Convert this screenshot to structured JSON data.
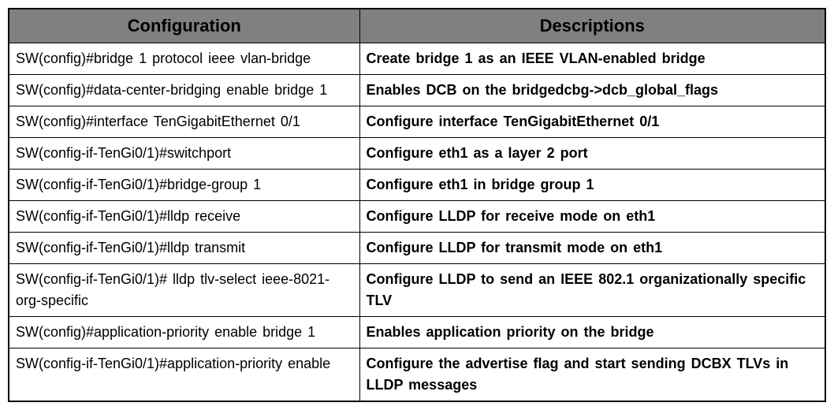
{
  "headers": {
    "configuration": "Configuration",
    "descriptions": "Descriptions"
  },
  "rows": [
    {
      "config": "SW(config)#bridge 1 protocol ieee vlan-bridge",
      "desc": "Create bridge 1 as an IEEE VLAN-enabled bridge"
    },
    {
      "config": "SW(config)#data-center-bridging enable bridge 1",
      "desc": "Enables DCB on the bridgedcbg->dcb_global_flags"
    },
    {
      "config": "SW(config)#interface TenGigabitEthernet 0/1",
      "desc": "Configure interface TenGigabitEthernet 0/1"
    },
    {
      "config": "SW(config-if-TenGi0/1)#switchport",
      "desc": "Configure eth1 as a layer 2 port"
    },
    {
      "config": "SW(config-if-TenGi0/1)#bridge-group 1",
      "desc": "Configure eth1 in bridge group 1"
    },
    {
      "config": "SW(config-if-TenGi0/1)#lldp receive",
      "desc": "Configure LLDP for receive mode on eth1"
    },
    {
      "config": "SW(config-if-TenGi0/1)#lldp transmit",
      "desc": "Configure LLDP for transmit mode on eth1"
    },
    {
      "config": "SW(config-if-TenGi0/1)# lldp tlv-select ieee-8021-org-specific",
      "desc": "Configure LLDP to send an IEEE 802.1 organizationally specific TLV"
    },
    {
      "config": "SW(config)#application-priority enable bridge 1",
      "desc": "Enables application priority on the bridge"
    },
    {
      "config": "SW(config-if-TenGi0/1)#application-priority enable",
      "desc": "Configure the advertise flag and start sending DCBX TLVs in LLDP messages"
    }
  ]
}
